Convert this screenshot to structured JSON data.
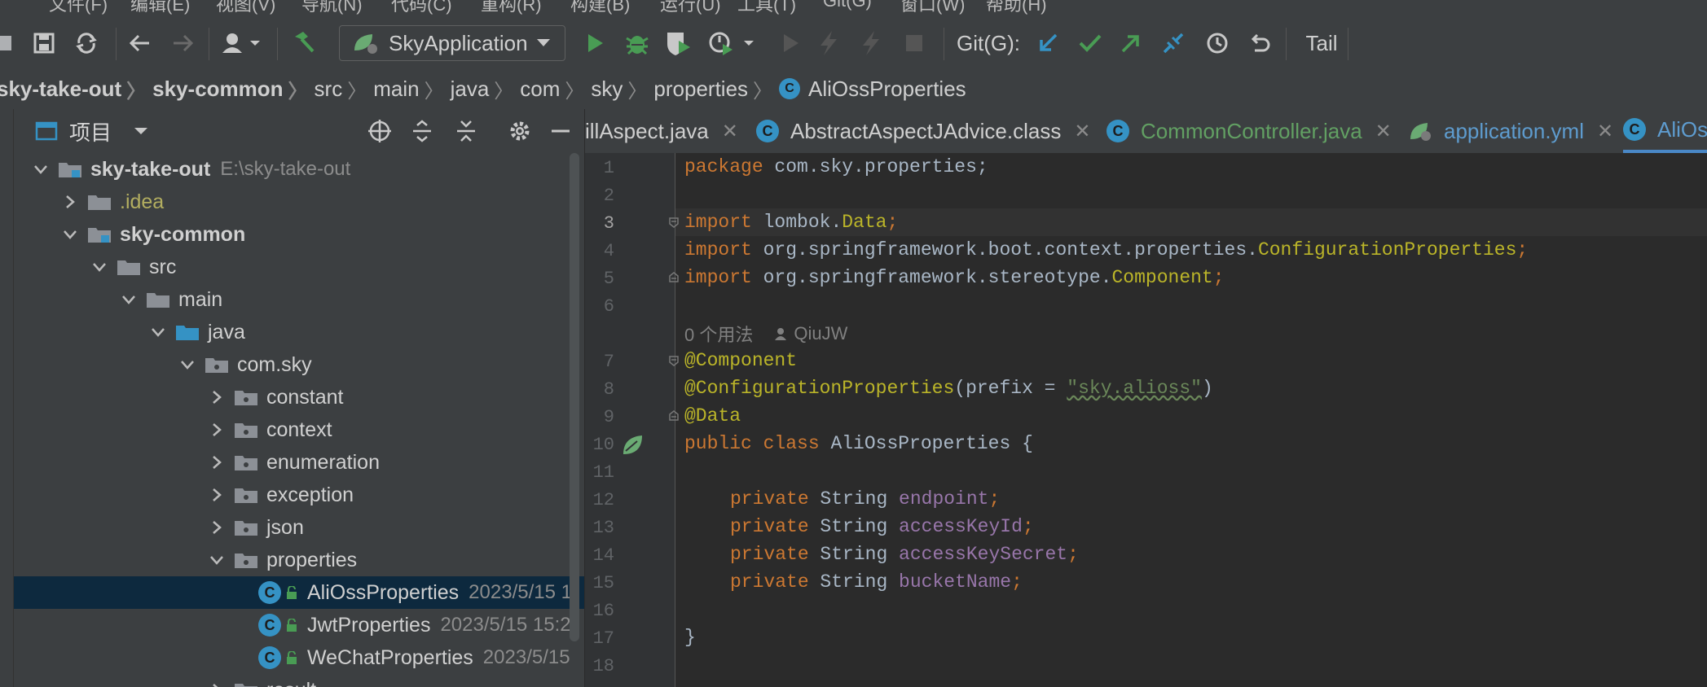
{
  "menubar": {
    "items": [
      "文件(F)",
      "编辑(E)",
      "视图(V)",
      "导航(N)",
      "代码(C)",
      "重构(R)",
      "构建(B)",
      "运行(U)",
      "工具(T)",
      "Git(G)",
      "窗口(W)",
      "帮助(H)"
    ]
  },
  "toolbar": {
    "run_config": "SkyApplication",
    "git_label": "Git(G):",
    "tail_label": "Tail"
  },
  "breadcrumb": [
    "sky-take-out",
    "sky-common",
    "src",
    "main",
    "java",
    "com",
    "sky",
    "properties",
    "AliOssProperties"
  ],
  "project_panel": {
    "title": "项目",
    "tree": [
      {
        "name": "sky-take-out",
        "meta": "E:\\sky-take-out"
      },
      {
        "name": ".idea"
      },
      {
        "name": "sky-common"
      },
      {
        "name": "src"
      },
      {
        "name": "main"
      },
      {
        "name": "java"
      },
      {
        "name": "com.sky"
      },
      {
        "name": "constant"
      },
      {
        "name": "context"
      },
      {
        "name": "enumeration"
      },
      {
        "name": "exception"
      },
      {
        "name": "json"
      },
      {
        "name": "properties"
      },
      {
        "name": "AliOssProperties",
        "meta": "2023/5/15 1"
      },
      {
        "name": "JwtProperties",
        "meta": "2023/5/15 15:2"
      },
      {
        "name": "WeChatProperties",
        "meta": "2023/5/15"
      },
      {
        "name": "result"
      }
    ]
  },
  "tabs": [
    {
      "label": "illAspect.java"
    },
    {
      "label": "AbstractAspectJAdvice.class"
    },
    {
      "label": "CommonController.java"
    },
    {
      "label": "application.yml"
    },
    {
      "label": "AliOs"
    }
  ],
  "editor": {
    "line_numbers": [
      "1",
      "2",
      "3",
      "4",
      "5",
      "6",
      "7",
      "8",
      "9",
      "10",
      "11",
      "12",
      "13",
      "14",
      "15",
      "16",
      "17",
      "18"
    ],
    "usage_hint": "0 个用法",
    "author_hint": "QiuJW",
    "code": {
      "l1_kw": "package",
      "l1_rest": " com.sky.properties;",
      "l3_kw": "import",
      "l3_rest": " lombok.",
      "l3_cls": "Data",
      "l3_end": ";",
      "l4_kw": "import",
      "l4_rest": " org.springframework.boot.context.properties.",
      "l4_cls": "ConfigurationProperties",
      "l4_end": ";",
      "l5_kw": "import",
      "l5_rest": " org.springframework.stereotype.",
      "l5_cls": "Component",
      "l5_end": ";",
      "l7_ann": "@Component",
      "l8_ann": "@ConfigurationProperties",
      "l8_rest": "(prefix = ",
      "l8_str": "\"sky.alioss\"",
      "l8_end": ")",
      "l9_ann": "@Data",
      "l10_kw": "public class",
      "l10_rest": " AliOssProperties {",
      "l12_kw": "private",
      "l12_type": " String ",
      "l12_fld": "endpoint",
      "l12_end": ";",
      "l13_kw": "private",
      "l13_type": " String ",
      "l13_fld": "accessKeyId",
      "l13_end": ";",
      "l14_kw": "private",
      "l14_type": " String ",
      "l14_fld": "accessKeySecret",
      "l14_end": ";",
      "l15_kw": "private",
      "l15_type": " String ",
      "l15_fld": "bucketName",
      "l15_end": ";",
      "l17": "}"
    }
  },
  "colors": {
    "keyword": "#cc7832",
    "annotation": "#bbb529",
    "string": "#6a8759",
    "field": "#9876aa",
    "accent": "#4a88c7",
    "run_green": "#499c54"
  }
}
